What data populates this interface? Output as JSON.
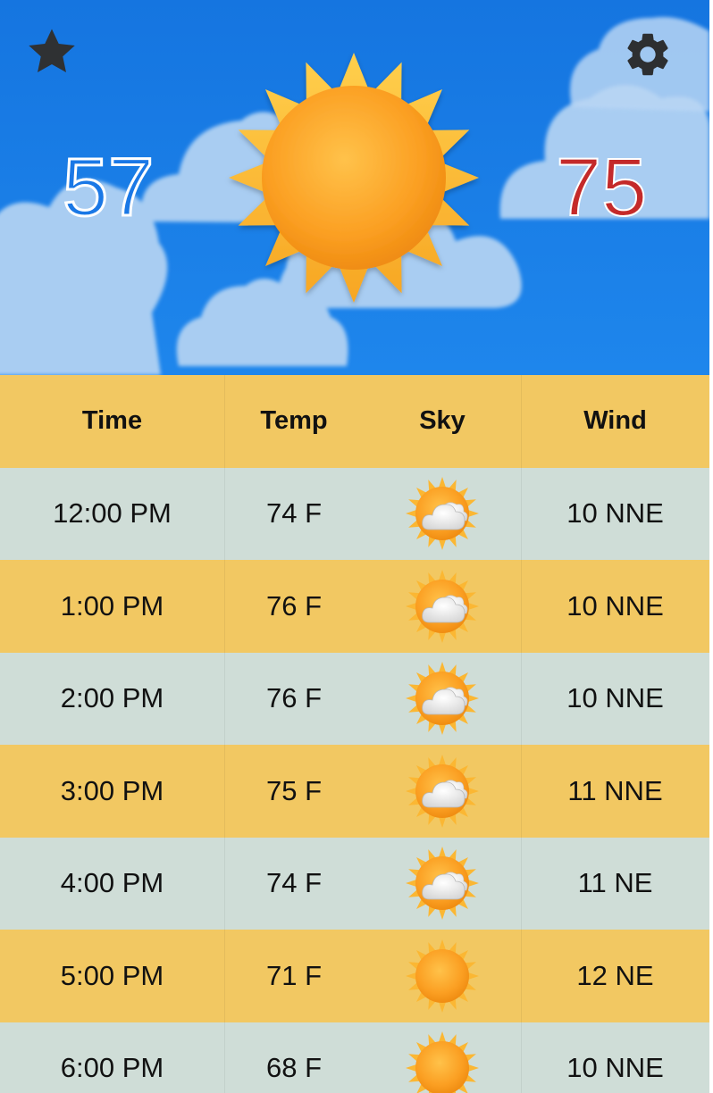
{
  "header": {
    "temp_low": "57",
    "temp_high": "75",
    "favorite_icon": "star-icon",
    "settings_icon": "gear-icon",
    "condition_icon": "sun-icon",
    "colors": {
      "sky": "#1e86ec",
      "low_temp": "#1a78e6",
      "high_temp": "#c42a2a"
    }
  },
  "table": {
    "headers": {
      "time": "Time",
      "temp": "Temp",
      "sky": "Sky",
      "wind": "Wind"
    },
    "rows": [
      {
        "time": "12:00 PM",
        "temp": "74 F",
        "sky": "partly-cloudy-icon",
        "wind": "10 NNE"
      },
      {
        "time": "1:00 PM",
        "temp": "76 F",
        "sky": "partly-cloudy-icon",
        "wind": "10 NNE"
      },
      {
        "time": "2:00 PM",
        "temp": "76 F",
        "sky": "partly-cloudy-icon",
        "wind": "10 NNE"
      },
      {
        "time": "3:00 PM",
        "temp": "75 F",
        "sky": "partly-cloudy-icon",
        "wind": "11 NNE"
      },
      {
        "time": "4:00 PM",
        "temp": "74 F",
        "sky": "partly-cloudy-icon",
        "wind": "11 NE"
      },
      {
        "time": "5:00 PM",
        "temp": "71 F",
        "sky": "sunny-icon",
        "wind": "12 NE"
      },
      {
        "time": "6:00 PM",
        "temp": "68 F",
        "sky": "sunny-icon",
        "wind": "10 NNE"
      }
    ],
    "colors": {
      "header_bg": "#f2c862",
      "row_a": "#cfddd7",
      "row_b": "#f2c862"
    }
  }
}
